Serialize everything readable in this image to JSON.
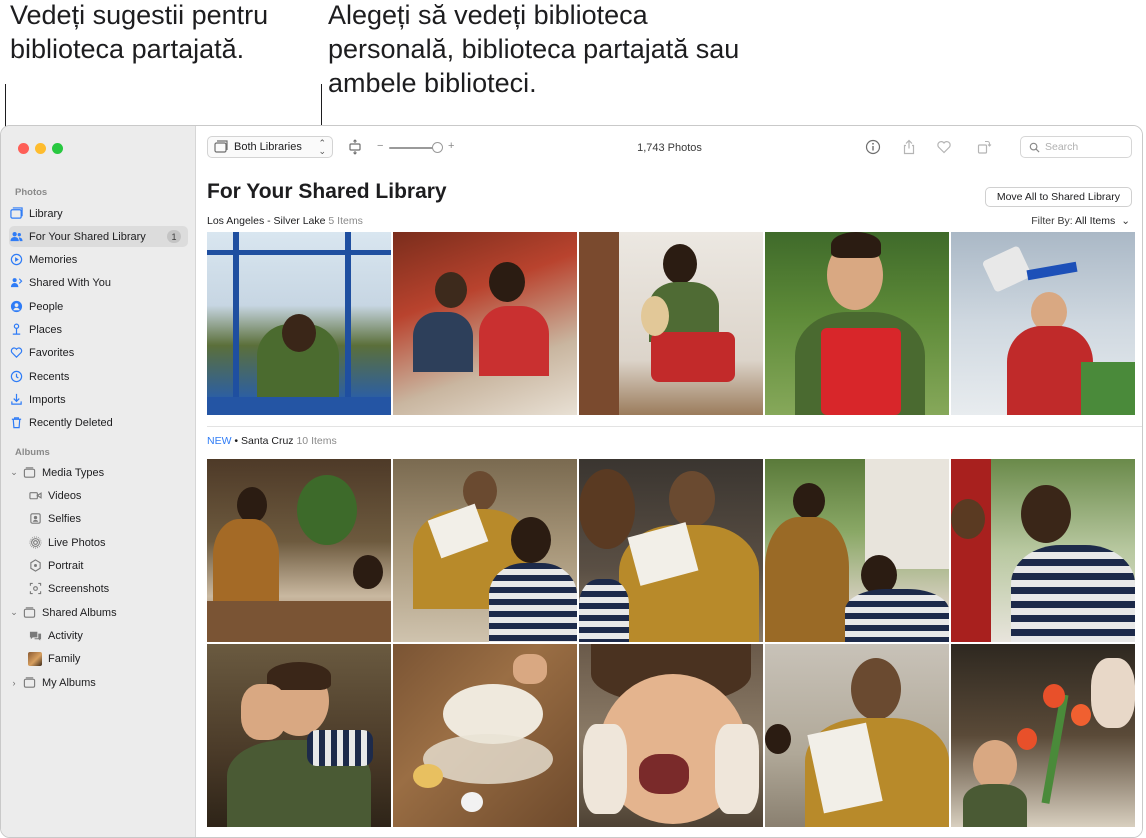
{
  "callouts": {
    "left": "Vedeți sugestii pentru biblioteca partajată.",
    "middle": "Alegeți să vedeți biblioteca personală, biblioteca partajată sau ambele biblioteci."
  },
  "sidebar": {
    "photos_section": "Photos",
    "albums_section": "Albums",
    "photos_items": [
      {
        "label": "Library",
        "icon": "library-icon"
      },
      {
        "label": "For Your Shared Library",
        "icon": "shared-people-icon",
        "badge": "1",
        "selected": true
      },
      {
        "label": "Memories",
        "icon": "memories-icon"
      },
      {
        "label": "Shared With You",
        "icon": "shared-with-you-icon"
      },
      {
        "label": "People",
        "icon": "people-icon"
      },
      {
        "label": "Places",
        "icon": "places-icon"
      },
      {
        "label": "Favorites",
        "icon": "heart-icon"
      },
      {
        "label": "Recents",
        "icon": "clock-icon"
      },
      {
        "label": "Imports",
        "icon": "import-icon"
      },
      {
        "label": "Recently Deleted",
        "icon": "trash-icon"
      }
    ],
    "albums_items": [
      {
        "label": "Media Types",
        "icon": "folder-icon",
        "expanded": true
      },
      {
        "label": "Videos",
        "icon": "video-icon"
      },
      {
        "label": "Selfies",
        "icon": "selfie-icon"
      },
      {
        "label": "Live Photos",
        "icon": "live-photo-icon"
      },
      {
        "label": "Portrait",
        "icon": "portrait-icon"
      },
      {
        "label": "Screenshots",
        "icon": "screenshot-icon"
      },
      {
        "label": "Shared Albums",
        "icon": "folder-icon",
        "expanded": true
      },
      {
        "label": "Activity",
        "icon": "activity-icon"
      },
      {
        "label": "Family",
        "icon": "family-thumbnail"
      },
      {
        "label": "My Albums",
        "icon": "folder-icon",
        "expanded": false
      }
    ]
  },
  "toolbar": {
    "library_selector": "Both Libraries",
    "photo_count": "1,743 Photos",
    "zoom_minus": "−",
    "zoom_plus": "+",
    "search_placeholder": "Search"
  },
  "main": {
    "title": "For Your Shared Library",
    "move_all_button": "Move All to Shared Library",
    "filter_label": "Filter By: ",
    "filter_value": "All Items",
    "groups": [
      {
        "new": "",
        "name": "Los Angeles - Silver Lake",
        "count": "5 Items"
      },
      {
        "new": "NEW",
        "name": "Santa Cruz",
        "count": "10 Items"
      }
    ]
  },
  "colors": {
    "accent": "#2f7cf6",
    "sidebar_bg": "#ececec",
    "close": "#fe5f57",
    "minimize": "#febc2e",
    "zoom": "#28c840"
  }
}
